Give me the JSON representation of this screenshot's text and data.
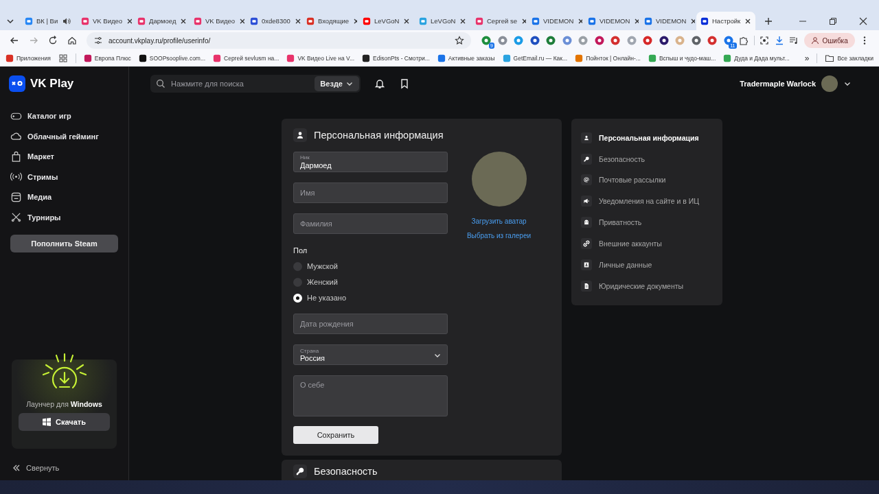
{
  "browser": {
    "tabs": [
      {
        "title": "ВК | Ви",
        "selected": false,
        "audio": true
      },
      {
        "title": "VK Видео",
        "selected": false,
        "audio": false
      },
      {
        "title": "Дармоед",
        "selected": false,
        "audio": false
      },
      {
        "title": "VK Видео",
        "selected": false,
        "audio": false
      },
      {
        "title": "0xde8300",
        "selected": false,
        "audio": false
      },
      {
        "title": "Входящие",
        "selected": false,
        "audio": false
      },
      {
        "title": "LeVGoN",
        "selected": false,
        "audio": false
      },
      {
        "title": "LeVGoN",
        "selected": false,
        "audio": false
      },
      {
        "title": "Сергей se",
        "selected": false,
        "audio": false
      },
      {
        "title": "VIDEMON",
        "selected": false,
        "audio": false
      },
      {
        "title": "VIDEMON",
        "selected": false,
        "audio": false
      },
      {
        "title": "VIDEMON",
        "selected": false,
        "audio": false
      },
      {
        "title": "Настройк",
        "selected": true,
        "audio": false
      }
    ],
    "url": "account.vkplay.ru/profile/userinfo/",
    "extension_badges": [
      "9",
      "11"
    ],
    "profile_button": "Ошибка",
    "bookmarks": [
      {
        "title": "Приложения"
      },
      {
        "title": "Европа Плюс"
      },
      {
        "title": "SOOPsooplive.com..."
      },
      {
        "title": "Сергей sevlusm на..."
      },
      {
        "title": "VK Видео Live на V..."
      },
      {
        "title": "EdisonPts - Смотри..."
      },
      {
        "title": "Активные заказы"
      },
      {
        "title": "GetEmail.ru — Как..."
      },
      {
        "title": "Пойнток | Онлайн-..."
      },
      {
        "title": "Вспыш и чудо-маш..."
      },
      {
        "title": "Дуда и Дада мульт..."
      }
    ],
    "bookmarks_more": "»",
    "all_bookmarks": "Все закладки"
  },
  "app": {
    "logo": "VK Play",
    "nav": [
      "Каталог игр",
      "Облачный гейминг",
      "Маркет",
      "Стримы",
      "Медиа",
      "Турниры"
    ],
    "topup_button": "Пополнить Steam",
    "launcher": {
      "text": "Лаунчер для **Windows**",
      "button": "Скачать"
    },
    "collapse": "Свернуть"
  },
  "header": {
    "search": {
      "placeholder": "Нажмите для поиска",
      "scope": "Везде"
    },
    "user": "Tradermaple Warlock"
  },
  "profile_form": {
    "title": "Персональная информация",
    "nick": {
      "label": "Ник",
      "value": "Дармоед"
    },
    "first_name": {
      "placeholder": "Имя"
    },
    "last_name": {
      "placeholder": "Фамилия"
    },
    "gender": {
      "label": "Пол",
      "options": [
        {
          "label": "Мужской",
          "selected": false
        },
        {
          "label": "Женский",
          "selected": false
        },
        {
          "label": "Не указано",
          "selected": true
        }
      ]
    },
    "birth_date": {
      "placeholder": "Дата рождения"
    },
    "country": {
      "label": "Страна",
      "value": "Россия"
    },
    "about": {
      "placeholder": "О себе"
    },
    "save_button": "Сохранить",
    "avatar_links": [
      "Загрузить аватар",
      "Выбрать из галереи"
    ]
  },
  "next_section": {
    "title": "Безопасность"
  },
  "settings_menu": [
    {
      "label": "Персональная информация",
      "selected": true
    },
    {
      "label": "Безопасность",
      "selected": false
    },
    {
      "label": "Почтовые рассылки",
      "selected": false
    },
    {
      "label": "Уведомления на сайте и в ИЦ",
      "selected": false
    },
    {
      "label": "Приватность",
      "selected": false
    },
    {
      "label": "Внешние аккаунты",
      "selected": false
    },
    {
      "label": "Личные данные",
      "selected": false
    },
    {
      "label": "Юридические документы",
      "selected": false
    }
  ]
}
